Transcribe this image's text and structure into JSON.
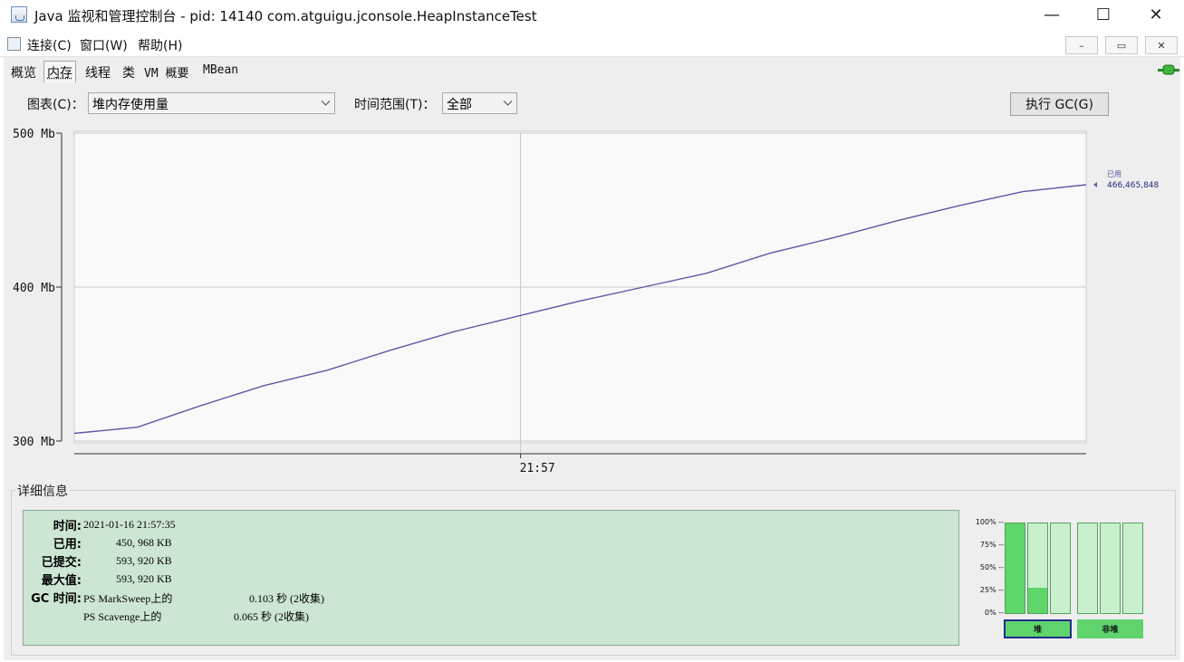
{
  "window": {
    "title": "Java 监视和管理控制台 - pid: 14140 com.atguigu.jconsole.HeapInstanceTest",
    "minimize": "—",
    "maximize": "☐",
    "close": "✕"
  },
  "menu": {
    "items": [
      "连接(C)",
      "窗口(W)",
      "帮助(H)"
    ],
    "mdi_minimize": "–",
    "mdi_restore": "▭",
    "mdi_close": "✕"
  },
  "tabs": [
    "概览",
    "内存",
    "线程",
    "类",
    "VM 概要",
    "MBean"
  ],
  "active_tab": "内存",
  "controls": {
    "chart_label": "图表(C)：",
    "chart_value": "堆内存使用量",
    "range_label": "时间范围(T)：",
    "range_value": "全部",
    "gc_button": "执行 GC(G)"
  },
  "chart_data": {
    "type": "line",
    "ylabels": [
      "500 Mb",
      "400 Mb",
      "300 Mb"
    ],
    "yticks": [
      500,
      400,
      300
    ],
    "ylim": [
      300,
      500
    ],
    "xlabel_tick": "21:57",
    "series": [
      {
        "name": "已用",
        "values": [
          305,
          309,
          323,
          336,
          346,
          359,
          371,
          381,
          391,
          400,
          409,
          422,
          432,
          443,
          453,
          462,
          466.465848
        ]
      }
    ],
    "last_value_label": "466,465,848",
    "color": "#5b5aa4",
    "grid": true
  },
  "details": {
    "section_title": "详细信息",
    "time_label": "时间:",
    "time_value": "2021-01-16 21:57:35",
    "used_label": "已用:",
    "used_value": "450, 968 KB",
    "committed_label": "已提交:",
    "committed_value": "593, 920 KB",
    "max_label": "最大值:",
    "max_value": "593, 920 KB",
    "gc_label": "GC 时间:",
    "gc1_name": "PS MarkSweep上的",
    "gc1_time": "0.103 秒 (2收集)",
    "gc2_name": "PS Scavenge上的",
    "gc2_time": "0.065 秒 (2收集)"
  },
  "memory_bars": {
    "percent_labels": [
      "100% --",
      "75% --",
      "50% --",
      "25% --",
      "0% --"
    ],
    "heap_fills": [
      1.0,
      0.28,
      0.0
    ],
    "nonheap_fills": [
      0.0,
      0.0,
      0.0
    ],
    "heap_label": "堆",
    "nonheap_label": "非堆"
  }
}
